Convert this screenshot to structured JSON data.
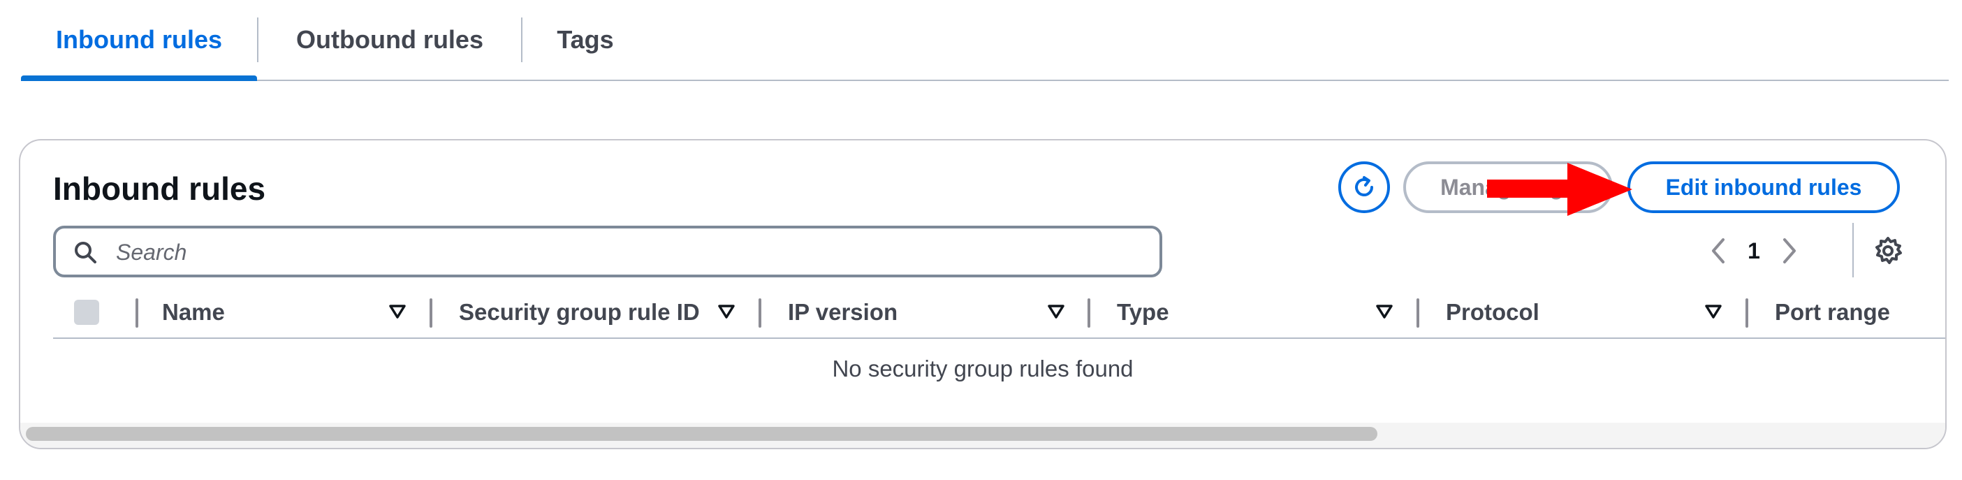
{
  "tabs": [
    {
      "label": "Inbound rules",
      "active": true
    },
    {
      "label": "Outbound rules",
      "active": false
    },
    {
      "label": "Tags",
      "active": false
    }
  ],
  "panel": {
    "title": "Inbound rules",
    "refresh_icon": "refresh-icon",
    "manage_tags_label": "Manage tags",
    "edit_label": "Edit inbound rules",
    "annotation_color": "#ff0000"
  },
  "search": {
    "placeholder": "Search",
    "value": ""
  },
  "pagination": {
    "current_page": "1"
  },
  "table": {
    "columns": [
      "Name",
      "Security group rule ID",
      "IP version",
      "Type",
      "Protocol",
      "Port range"
    ],
    "empty_message": "No security group rules found"
  },
  "colors": {
    "accent": "#006ce0",
    "text": "#0f141a",
    "muted": "#424650"
  }
}
